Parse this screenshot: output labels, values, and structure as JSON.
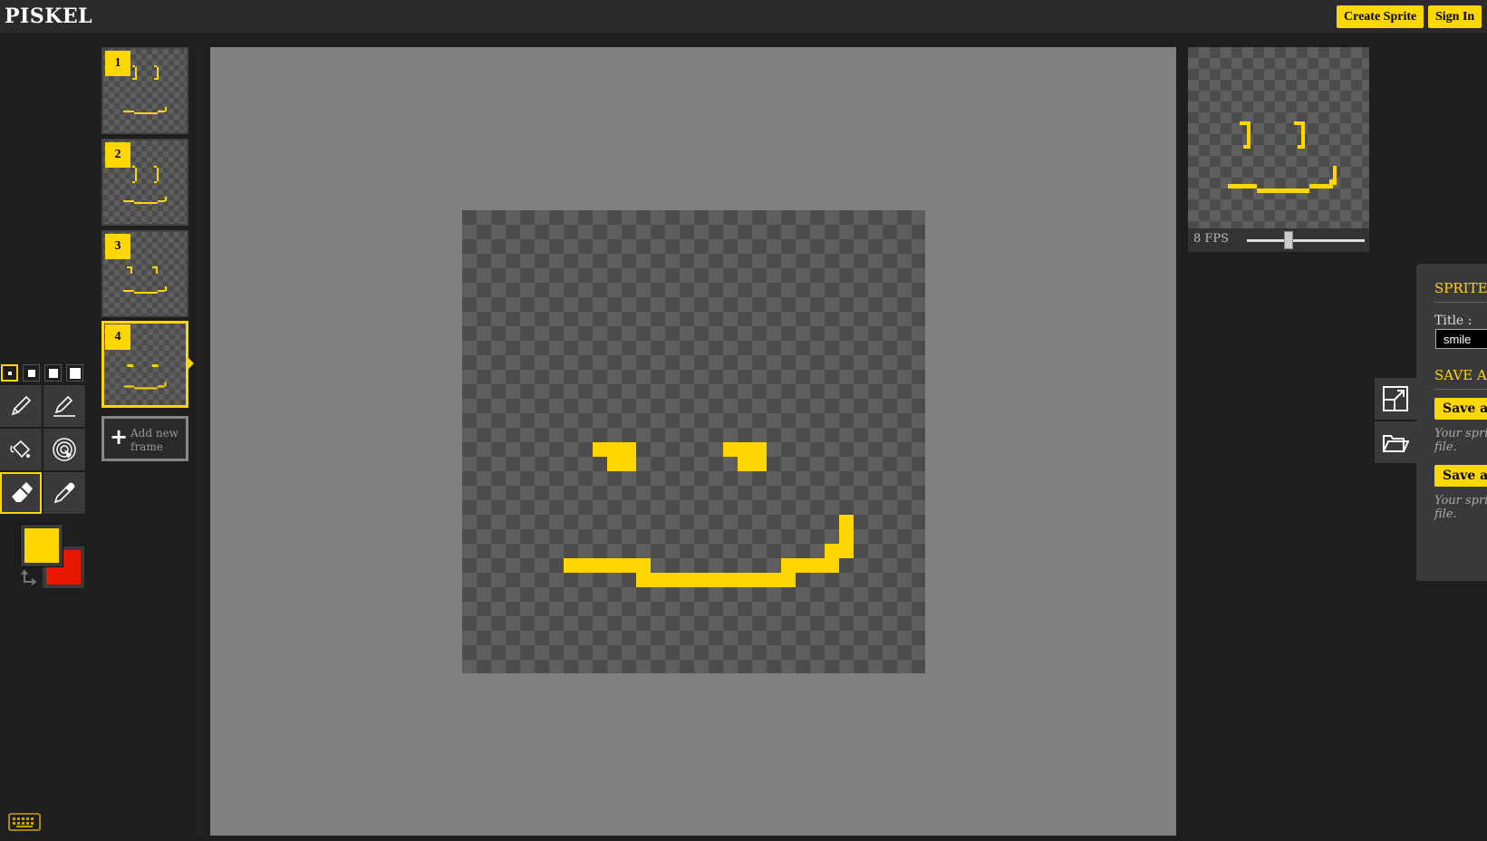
{
  "header": {
    "logo": "PISKEL",
    "create_sprite": "Create Sprite",
    "sign_in": "Sign In"
  },
  "tools": {
    "pen_sizes": [
      1,
      2,
      3,
      4
    ],
    "selected_pen_size": 1,
    "items": [
      "pen-icon",
      "vertical-mirror-pen-icon",
      "paint-bucket-icon",
      "paint-all-same-color-icon",
      "eraser-icon",
      "color-picker-icon"
    ],
    "selected": "eraser-icon",
    "primary_color": "#ffd700",
    "secondary_color": "#e61a00"
  },
  "frames": {
    "items": [
      {
        "number": "1"
      },
      {
        "number": "2"
      },
      {
        "number": "3"
      },
      {
        "number": "4"
      }
    ],
    "selected": "4",
    "add_label": "Add new frame"
  },
  "preview": {
    "fps_label": "8 FPS",
    "fps": 8
  },
  "settings": {
    "sprite_heading": "SPRITE",
    "title_label": "Title :",
    "title_value": "smile",
    "save_heading": "SAVE AS",
    "save_btn_1": "Save as",
    "save_desc_1a": "Your sprite",
    "save_desc_1b": "file.",
    "save_btn_2": "Save as",
    "save_desc_2a": "Your sprite",
    "save_desc_2b": "file."
  },
  "colors": {
    "accent": "#ffd700",
    "background": "#1e1e1e",
    "canvas_bg": "#808080"
  }
}
